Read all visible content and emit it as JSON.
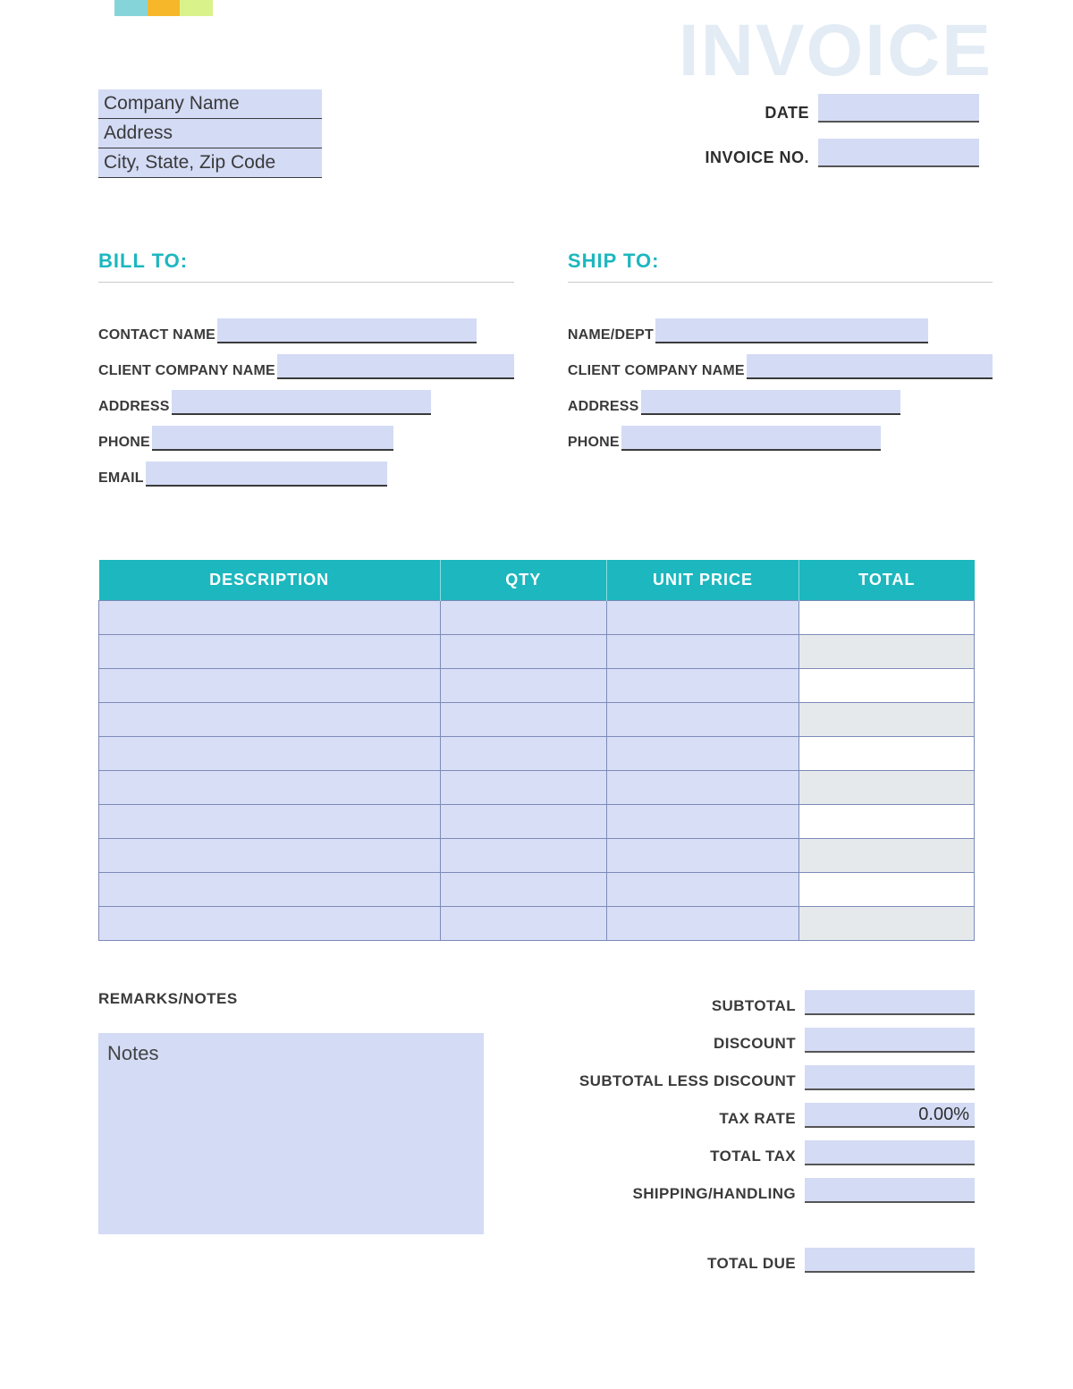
{
  "colors": {
    "accent": "#1cb7bf",
    "highlight": "#d4dbf5"
  },
  "title": "INVOICE",
  "company": {
    "name": "Company Name",
    "address": "Address",
    "city_state_zip": "City, State, Zip Code"
  },
  "meta": {
    "date_label": "DATE",
    "date_value": "",
    "invoice_no_label": "INVOICE NO.",
    "invoice_no_value": ""
  },
  "bill_to": {
    "title": "BILL TO:",
    "fields": {
      "contact_label": "CONTACT NAME",
      "company_label": "CLIENT COMPANY NAME",
      "address_label": "ADDRESS",
      "phone_label": "PHONE",
      "email_label": "EMAIL"
    },
    "values": {
      "contact": "",
      "company": "",
      "address": "",
      "phone": "",
      "email": ""
    }
  },
  "ship_to": {
    "title": "SHIP TO:",
    "fields": {
      "name_label": "NAME/DEPT",
      "company_label": "CLIENT COMPANY NAME",
      "address_label": "ADDRESS",
      "phone_label": "PHONE"
    },
    "values": {
      "name": "",
      "company": "",
      "address": "",
      "phone": ""
    }
  },
  "table": {
    "headers": {
      "description": "DESCRIPTION",
      "qty": "QTY",
      "unit_price": "UNIT PRICE",
      "total": "TOTAL"
    },
    "rows": [
      {
        "description": "",
        "qty": "",
        "unit_price": "",
        "total": ""
      },
      {
        "description": "",
        "qty": "",
        "unit_price": "",
        "total": ""
      },
      {
        "description": "",
        "qty": "",
        "unit_price": "",
        "total": ""
      },
      {
        "description": "",
        "qty": "",
        "unit_price": "",
        "total": ""
      },
      {
        "description": "",
        "qty": "",
        "unit_price": "",
        "total": ""
      },
      {
        "description": "",
        "qty": "",
        "unit_price": "",
        "total": ""
      },
      {
        "description": "",
        "qty": "",
        "unit_price": "",
        "total": ""
      },
      {
        "description": "",
        "qty": "",
        "unit_price": "",
        "total": ""
      },
      {
        "description": "",
        "qty": "",
        "unit_price": "",
        "total": ""
      },
      {
        "description": "",
        "qty": "",
        "unit_price": "",
        "total": ""
      }
    ]
  },
  "notes": {
    "title": "REMARKS/NOTES",
    "placeholder": "Notes",
    "value": ""
  },
  "totals": {
    "subtotal": {
      "label": "SUBTOTAL",
      "value": ""
    },
    "discount": {
      "label": "DISCOUNT",
      "value": ""
    },
    "sub_less_disc": {
      "label": "SUBTOTAL LESS DISCOUNT",
      "value": ""
    },
    "tax_rate": {
      "label": "TAX RATE",
      "value": "0.00%"
    },
    "total_tax": {
      "label": "TOTAL TAX",
      "value": ""
    },
    "shipping": {
      "label": "SHIPPING/HANDLING",
      "value": ""
    },
    "total_due": {
      "label": "TOTAL DUE",
      "value": ""
    }
  }
}
